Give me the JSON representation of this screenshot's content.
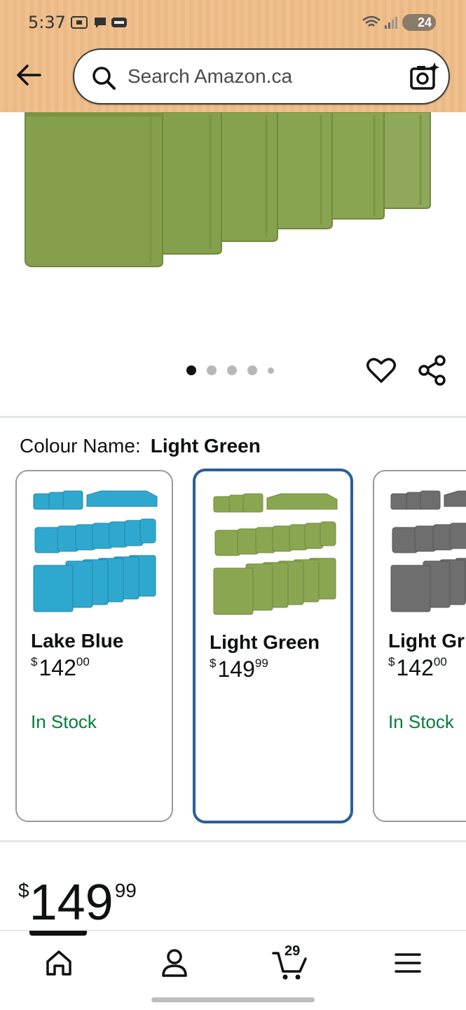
{
  "status_bar": {
    "time": "5:37",
    "battery": "24"
  },
  "header": {
    "search_placeholder": "Search Amazon.ca"
  },
  "gallery": {
    "dot_count": 5,
    "active_index": 0
  },
  "colour": {
    "label": "Colour Name:",
    "selected": "Light Green",
    "options": [
      {
        "name": "Lake Blue",
        "currency": "$",
        "dollars": "142",
        "cents": "00",
        "stock": "In Stock",
        "swatch": "#2fa8cf"
      },
      {
        "name": "Light Green",
        "currency": "$",
        "dollars": "149",
        "cents": "99",
        "stock": "",
        "swatch": "#8aa651"
      },
      {
        "name": "Light Gr",
        "currency": "$",
        "dollars": "142",
        "cents": "00",
        "stock": "In Stock",
        "swatch": "#6e6e6e"
      }
    ]
  },
  "price": {
    "currency": "$",
    "dollars": "149",
    "cents": "99"
  },
  "bottom_nav": {
    "cart_count": "29",
    "items": [
      "home-icon",
      "account-icon",
      "cart-icon",
      "menu-icon"
    ]
  },
  "colors": {
    "header_bg": "#efc08d",
    "selected_border": "#2a5f99",
    "in_stock": "#067d3a"
  }
}
